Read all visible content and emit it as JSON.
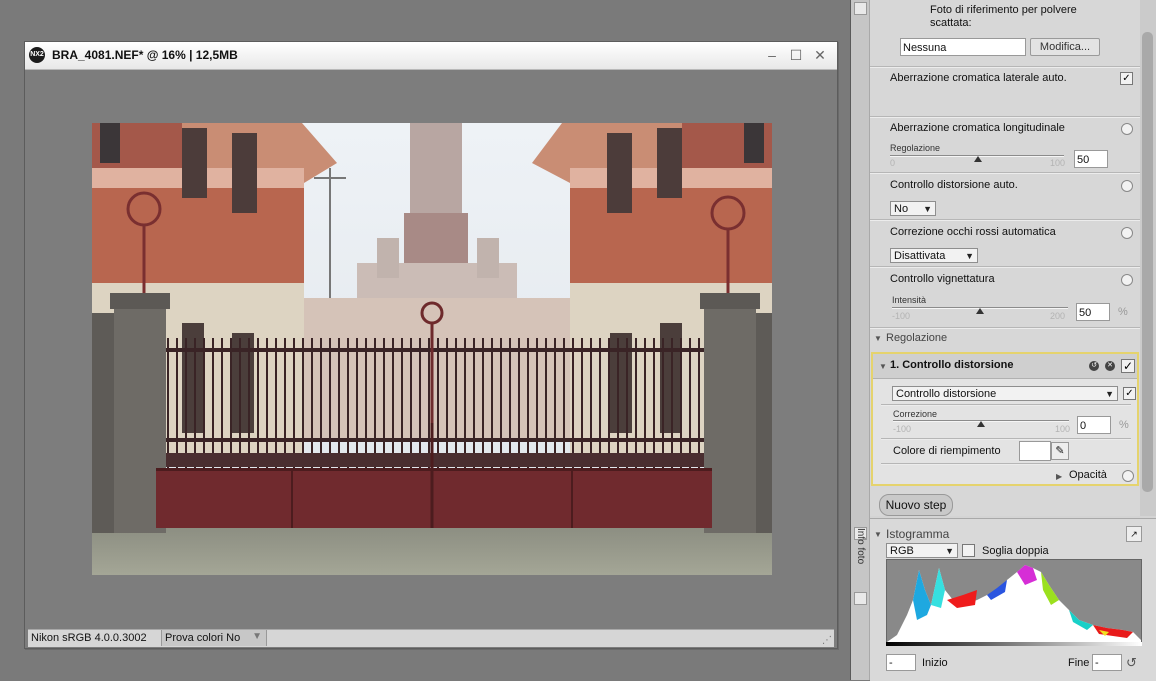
{
  "window": {
    "title": "BRA_4081.NEF* @ 16% | 12,5MB",
    "logo_text": "NX2",
    "minimize_glyph": "‒",
    "maximize_glyph": "☐",
    "close_glyph": "✕"
  },
  "status_bar": {
    "profile": "Nikon sRGB 4.0.0.3002",
    "softproof_label": "Prova colori No",
    "softproof_arrow": "▼",
    "resize_glyph": "⋰"
  },
  "panel": {
    "dust_ref_label": "Foto di riferimento per polvere scattata:",
    "dust_ref_value": "Nessuna",
    "dust_ref_button": "Modifica...",
    "lateral_ca_label": "Aberrazione cromatica laterale auto.",
    "lateral_ca_checked": true,
    "axial_ca_label": "Aberrazione cromatica longitudinale",
    "axial_ca_regolazione_label": "Regolazione",
    "axial_ca_min": "0",
    "axial_ca_max": "100",
    "axial_ca_value": "50",
    "auto_distortion_label": "Controllo distorsione auto.",
    "auto_distortion_value": "No",
    "redeye_label": "Correzione occhi rossi automatica",
    "redeye_value": "Disattivata",
    "vignette_label": "Controllo vignettatura",
    "vignette_intensity_label": "Intensità",
    "vignette_min": "-100",
    "vignette_max": "200",
    "vignette_value": "50",
    "vignette_unit": "%",
    "regolazione_section": "Regolazione"
  },
  "step": {
    "title": "1. Controllo distorsione",
    "reset_glyph": "↺",
    "delete_glyph": "✕",
    "enabled_glyph": "✓",
    "mode_value": "Controllo distorsione",
    "mode_checked": true,
    "correction_label": "Correzione",
    "correction_min": "-100",
    "correction_max": "100",
    "correction_value": "0",
    "correction_unit": "%",
    "fill_color_label": "Colore di riempimento",
    "eyedropper_glyph": "✎",
    "opacity_label": "Opacità",
    "triangle_glyph": "▶",
    "slider_levels": {
      "axial_ca": 0.5,
      "vignette": 0.5,
      "correction": 0.5
    }
  },
  "new_step_button": "Nuovo step",
  "histogram": {
    "title": "Istogramma",
    "channel": "RGB",
    "double_threshold_label": "Soglia doppia",
    "start_label": "Inizio",
    "end_label": "Fine",
    "start_value": "-",
    "end_value": "-",
    "side_tab_label": "Info foto"
  }
}
